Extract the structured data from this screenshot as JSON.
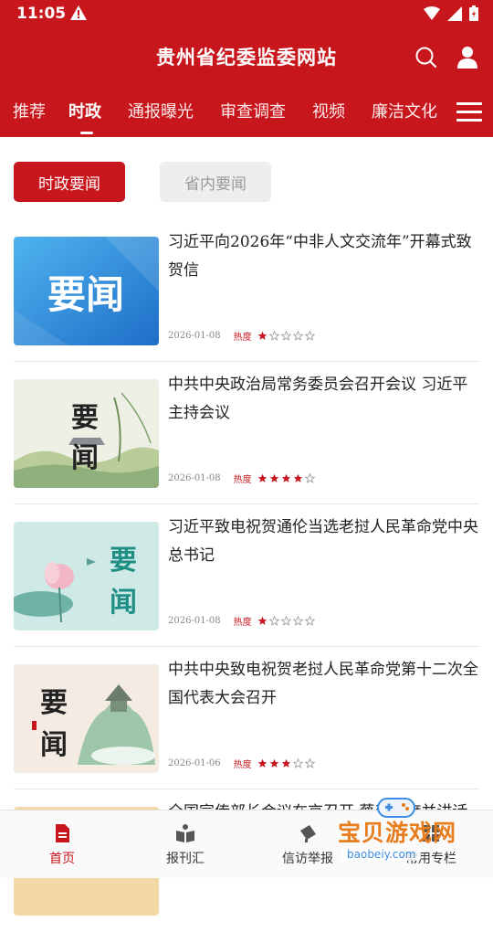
{
  "status": {
    "time": "11:05"
  },
  "header": {
    "title": "贵州省纪委监委网站"
  },
  "tabs": [
    {
      "label": "推荐",
      "active": false
    },
    {
      "label": "时政",
      "active": true
    },
    {
      "label": "通报曝光",
      "active": false
    },
    {
      "label": "审查调查",
      "active": false
    },
    {
      "label": "视频",
      "active": false
    },
    {
      "label": "廉洁文化",
      "active": false
    }
  ],
  "subtabs": [
    {
      "label": "时政要闻",
      "active": true
    },
    {
      "label": "省内要闻",
      "active": false
    }
  ],
  "thumb_text": [
    "要闻",
    "要",
    "闻"
  ],
  "heat_label": "热度",
  "news": [
    {
      "title": "习近平向2026年“中非人文交流年”开幕式致贺信",
      "date": "2026-01-08",
      "heat": 1
    },
    {
      "title": "中共中央政治局常务委员会召开会议 习近平主持会议",
      "date": "2026-01-08",
      "heat": 4
    },
    {
      "title": "习近平致电祝贺通伦当选老挝人民革命党中央总书记",
      "date": "2026-01-08",
      "heat": 1
    },
    {
      "title": "中共中央致电祝贺老挝人民革命党第十二次全国代表大会召开",
      "date": "2026-01-06",
      "heat": 3
    },
    {
      "title": "全国宣传部长会议在京召开 蔡奇出席并讲话",
      "date": "",
      "heat": 0
    }
  ],
  "bottom_nav": [
    {
      "label": "首页",
      "icon": "document-icon",
      "active": true
    },
    {
      "label": "报刊汇",
      "icon": "book-icon",
      "active": false
    },
    {
      "label": "信访举报",
      "icon": "report-icon",
      "active": false
    },
    {
      "label": "常用专栏",
      "icon": "column-icon",
      "active": false
    }
  ],
  "watermark": {
    "text": "宝贝游戏网",
    "url": "baobeiy.com"
  },
  "colors": {
    "brand": "#c8161d",
    "tab_inactive": "#eeeeee"
  }
}
